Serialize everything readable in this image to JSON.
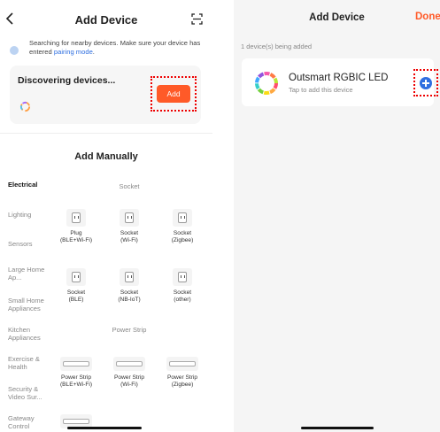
{
  "left": {
    "title": "Add Device",
    "icons": {
      "back": "chevron-left-icon",
      "scan": "scan-icon"
    },
    "search": {
      "text": "Searching for nearby devices. Make sure your device has entered",
      "link": "pairing mode",
      "suffix": "."
    },
    "discover": {
      "title": "Discovering devices...",
      "add_label": "Add",
      "accent": "#ff5a28"
    },
    "manual_title": "Add Manually",
    "categories": [
      "Electrical",
      "Lighting",
      "Sensors",
      "Large Home Ap...",
      "Small Home Appliances",
      "Kitchen Appliances",
      "Exercise & Health",
      "Security & Video Sur...",
      "Gateway Control"
    ],
    "sections": {
      "socket": "Socket",
      "power_strip": "Power Strip"
    },
    "sockets": [
      {
        "l1": "Plug",
        "l2": "(BLE+Wi-Fi)"
      },
      {
        "l1": "Socket",
        "l2": "(Wi-Fi)"
      },
      {
        "l1": "Socket",
        "l2": "(Zigbee)"
      },
      {
        "l1": "Socket",
        "l2": "(BLE)"
      },
      {
        "l1": "Socket",
        "l2": "(NB-IoT)"
      },
      {
        "l1": "Socket",
        "l2": "(other)"
      }
    ],
    "strips": [
      {
        "l1": "Power Strip",
        "l2": "(BLE+Wi-Fi)"
      },
      {
        "l1": "Power Strip",
        "l2": "(Wi-Fi)"
      },
      {
        "l1": "Power Strip",
        "l2": "(Zigbee)"
      }
    ]
  },
  "right": {
    "title": "Add Device",
    "done_label": "Done",
    "count_text": "1 device(s) being added",
    "device": {
      "name": "Outsmart RGBIC LED",
      "subtitle": "Tap to add this device",
      "icon": "rgb-ring-icon",
      "add_icon": "plus-circle-icon"
    }
  },
  "colors": {
    "accent": "#ff5a28",
    "link": "#2f6fe0",
    "highlight": "#e00000"
  }
}
